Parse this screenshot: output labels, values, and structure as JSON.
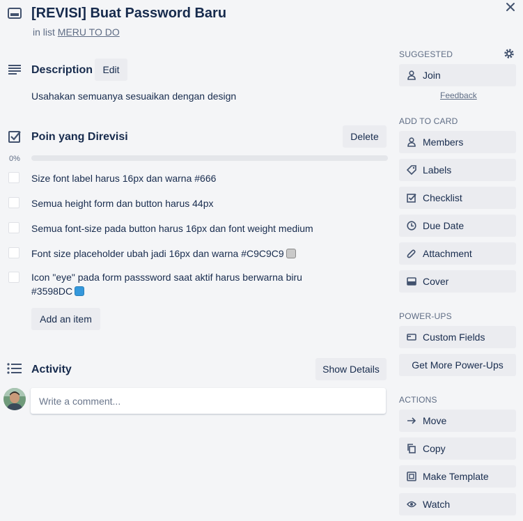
{
  "card": {
    "title": "[REVISI] Buat Password Baru",
    "in_list_prefix": "in list",
    "list_name": "MERU TO DO"
  },
  "description": {
    "heading": "Description",
    "edit_label": "Edit",
    "text": "Usahakan semuanya sesuaikan dengan design"
  },
  "checklist": {
    "heading": "Poin yang Direvisi",
    "delete_label": "Delete",
    "progress_text": "0%",
    "progress_value": 0,
    "items": [
      {
        "text": "Size font label harus 16px dan warna #666",
        "checked": false
      },
      {
        "text": "Semua height form dan button harus 44px",
        "checked": false
      },
      {
        "text": "Semua font-size pada button harus 16px dan font weight medium",
        "checked": false
      },
      {
        "text": "Font size placeholder ubah jadi 16px dan warna #C9C9C9",
        "checked": false,
        "swatch": "#C9C9C9"
      },
      {
        "text_line1": "Icon \"eye\" pada form passsword saat aktif harus berwarna biru",
        "text_line2": "#3598DC",
        "checked": false,
        "swatch": "#3598DC"
      }
    ],
    "add_item_label": "Add an item"
  },
  "activity": {
    "heading": "Activity",
    "show_details_label": "Show Details",
    "comment_placeholder": "Write a comment..."
  },
  "sidebar": {
    "suggested_heading": "SUGGESTED",
    "join_label": "Join",
    "feedback_label": "Feedback",
    "add_to_card_heading": "ADD TO CARD",
    "add_to_card": [
      {
        "label": "Members",
        "icon": "person-icon"
      },
      {
        "label": "Labels",
        "icon": "tag-icon"
      },
      {
        "label": "Checklist",
        "icon": "checklist-icon"
      },
      {
        "label": "Due Date",
        "icon": "clock-icon"
      },
      {
        "label": "Attachment",
        "icon": "paperclip-icon"
      },
      {
        "label": "Cover",
        "icon": "cover-icon"
      }
    ],
    "power_ups_heading": "POWER-UPS",
    "custom_fields_label": "Custom Fields",
    "get_more_label": "Get More Power-Ups",
    "actions_heading": "ACTIONS",
    "actions": [
      {
        "label": "Move",
        "icon": "arrow-right-icon"
      },
      {
        "label": "Copy",
        "icon": "copy-icon"
      },
      {
        "label": "Make Template",
        "icon": "template-icon"
      },
      {
        "label": "Watch",
        "icon": "eye-icon"
      }
    ]
  },
  "colors": {
    "swatch_grey": "#C9C9C9",
    "swatch_blue": "#3598DC"
  }
}
